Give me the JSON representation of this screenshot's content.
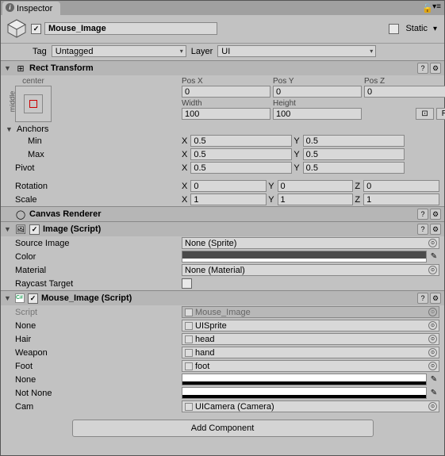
{
  "tab": {
    "title": "Inspector"
  },
  "header": {
    "name": "Mouse_Image",
    "enabled": true,
    "static_label": "Static",
    "tag_label": "Tag",
    "tag_value": "Untagged",
    "layer_label": "Layer",
    "layer_value": "UI"
  },
  "rect": {
    "title": "Rect Transform",
    "anchor_center": "center",
    "anchor_middle": "middle",
    "posx_lbl": "Pos X",
    "posx": "0",
    "posy_lbl": "Pos Y",
    "posy": "0",
    "posz_lbl": "Pos Z",
    "posz": "0",
    "width_lbl": "Width",
    "width": "100",
    "height_lbl": "Height",
    "height": "100",
    "blueprint": "⊡",
    "raw": "R",
    "anchors_lbl": "Anchors",
    "min_lbl": "Min",
    "min_x": "0.5",
    "min_y": "0.5",
    "max_lbl": "Max",
    "max_x": "0.5",
    "max_y": "0.5",
    "pivot_lbl": "Pivot",
    "pivot_x": "0.5",
    "pivot_y": "0.5",
    "rot_lbl": "Rotation",
    "rot_x": "0",
    "rot_y": "0",
    "rot_z": "0",
    "scale_lbl": "Scale",
    "scale_x": "1",
    "scale_y": "1",
    "scale_z": "1",
    "x": "X",
    "y": "Y",
    "z": "Z"
  },
  "canvas": {
    "title": "Canvas Renderer"
  },
  "image": {
    "title": "Image (Script)",
    "source_lbl": "Source Image",
    "source_val": "None (Sprite)",
    "color_lbl": "Color",
    "material_lbl": "Material",
    "material_val": "None (Material)",
    "raycast_lbl": "Raycast Target"
  },
  "mouse": {
    "title": "Mouse_Image (Script)",
    "script_lbl": "Script",
    "script_val": "Mouse_Image",
    "none_lbl": "None",
    "none_val": "UISprite",
    "hair_lbl": "Hair",
    "hair_val": "head",
    "weapon_lbl": "Weapon",
    "weapon_val": "hand",
    "foot_lbl": "Foot",
    "foot_val": "foot",
    "none2_lbl": "None",
    "notnone_lbl": "Not None",
    "cam_lbl": "Cam",
    "cam_val": "UICamera (Camera)"
  },
  "add_component": "Add Component"
}
